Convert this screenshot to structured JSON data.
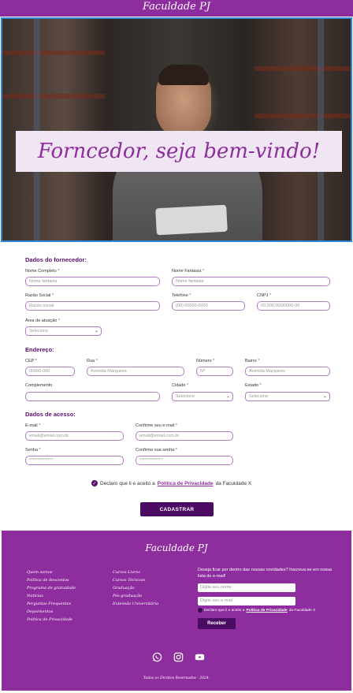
{
  "brand": {
    "logo_text": "Faculdade PJ"
  },
  "hero": {
    "banner_text": "Forncedor, seja bem-vindo!"
  },
  "form": {
    "supplier_section_title": "Dados do fornecedor:",
    "full_name": {
      "label": "Nome Completo",
      "placeholder": "Nome fantasia"
    },
    "trade_name": {
      "label": "Nome Fantasia",
      "placeholder": "Nome fantasia"
    },
    "company_name": {
      "label": "Razão Social",
      "placeholder": "Razão social"
    },
    "phone": {
      "label": "Telefone",
      "placeholder": "(00) 00000-0000"
    },
    "cnpj": {
      "label": "CNPJ",
      "placeholder": "00.000.000/0000-00"
    },
    "area": {
      "label": "Área de atuação",
      "value": "Selecione"
    },
    "address_section_title": "Endereço:",
    "cep": {
      "label": "CEP",
      "placeholder": "00000-000"
    },
    "street": {
      "label": "Rua",
      "placeholder": "Avenida Marquees"
    },
    "number": {
      "label": "Número",
      "placeholder": "Nº"
    },
    "district": {
      "label": "Bairro",
      "placeholder": "Avenida Marquees"
    },
    "complement": {
      "label": "Complemento",
      "placeholder": ""
    },
    "city": {
      "label": "Cidade",
      "value": "Selecione"
    },
    "state": {
      "label": "Estado",
      "value": "Selecione"
    },
    "access_section_title": "Dados de acesso:",
    "email": {
      "label": "E-mail",
      "placeholder": "email@email.com.br"
    },
    "email_confirm": {
      "label": "Confirme seu e-mail",
      "placeholder": "email@email.com.br"
    },
    "password": {
      "label": "Senha",
      "placeholder": "**************"
    },
    "password_confirm": {
      "label": "Confirme sua senha",
      "placeholder": "**************"
    },
    "consent_prefix": "Declaro que li e aceito a",
    "consent_link": "Política de Privacidade",
    "consent_suffix": "da Faculdade X",
    "submit_label": "CADASTRAR",
    "required_mark": "*"
  },
  "footer": {
    "logo_text": "Faculdade PJ",
    "links_col1": [
      "Quem somos",
      "Política de descontos",
      "Programa de gratuidade",
      "Notícias",
      "Perguntas Frequentes",
      "Depoimentos",
      "Política de Privacidade"
    ],
    "links_col2": [
      "Cursos Livres",
      "Cursos Técnicos",
      "Graduação",
      "Pós-graduação",
      "Extensão Universitária"
    ],
    "newsletter_text": "Deseja ficar por dentro das nossas novidades? Inscreva-se em nossa lista de e-mail!",
    "name_placeholder": "Digite seu nome",
    "email_placeholder": "Digite seu e-mail",
    "consent_prefix": "Declaro que li e aceito a",
    "consent_link": "Política de Privacidade",
    "consent_suffix": "da Faculdade X",
    "button_label": "Receber",
    "copyright": "Todos os Direitos Reservados - 2024.",
    "social_icons": [
      "whatsapp-icon",
      "instagram-icon",
      "youtube-icon"
    ]
  },
  "colors": {
    "brand_purple": "#8e2d9d",
    "dark_purple": "#4c0b63",
    "hero_border": "#2f86d6"
  }
}
